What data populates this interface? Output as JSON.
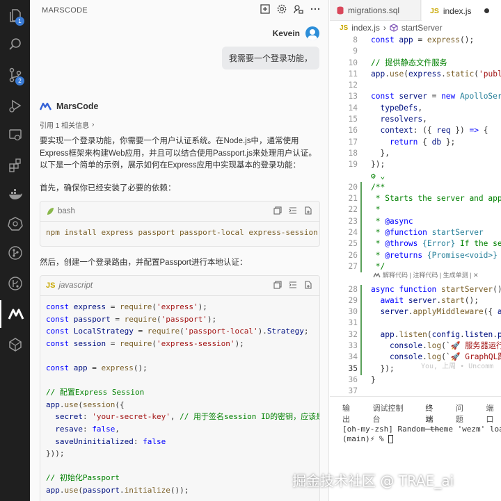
{
  "activity_bar": {
    "explorer_badge": "1",
    "scm_badge": "2"
  },
  "panel": {
    "title": "MARSCODE",
    "user_name": "Kevein",
    "user_message": "我需要一个登录功能，",
    "assistant_name": "MarsCode",
    "reference_info": "引用 1 相关信息",
    "para1": "要实现一个登录功能，你需要一个用户认证系统。在Node.js中，通常使用Express框架来构建Web应用，并且可以结合使用Passport.js来处理用户认证。以下是一个简单的示例，展示如何在Express应用中实现基本的登录功能：",
    "para2": "首先，确保你已经安装了必要的依赖：",
    "bash_lang": "bash",
    "bash_code": "npm install express passport passport-local express-session",
    "para3": "然后，创建一个登录路由，并配置Passport进行本地认证：",
    "js_lang": "javascript",
    "js_lines": [
      [
        [
          "kw",
          "const "
        ],
        [
          "vr",
          "express"
        ],
        [
          "plain",
          " = "
        ],
        [
          "fn",
          "require"
        ],
        [
          "plain",
          "("
        ],
        [
          "str",
          "'express'"
        ],
        [
          "plain",
          ");"
        ]
      ],
      [
        [
          "kw",
          "const "
        ],
        [
          "vr",
          "passport"
        ],
        [
          "plain",
          " = "
        ],
        [
          "fn",
          "require"
        ],
        [
          "plain",
          "("
        ],
        [
          "str",
          "'passport'"
        ],
        [
          "plain",
          ");"
        ]
      ],
      [
        [
          "kw",
          "const "
        ],
        [
          "vr",
          "LocalStrategy"
        ],
        [
          "plain",
          " = "
        ],
        [
          "fn",
          "require"
        ],
        [
          "plain",
          "("
        ],
        [
          "str",
          "'passport-local'"
        ],
        [
          "plain",
          ")."
        ],
        [
          "vr",
          "Strategy"
        ],
        [
          "plain",
          ";"
        ]
      ],
      [
        [
          "kw",
          "const "
        ],
        [
          "vr",
          "session"
        ],
        [
          "plain",
          " = "
        ],
        [
          "fn",
          "require"
        ],
        [
          "plain",
          "("
        ],
        [
          "str",
          "'express-session'"
        ],
        [
          "plain",
          ");"
        ]
      ],
      [],
      [
        [
          "kw",
          "const "
        ],
        [
          "vr",
          "app"
        ],
        [
          "plain",
          " = "
        ],
        [
          "fn",
          "express"
        ],
        [
          "plain",
          "();"
        ]
      ],
      [],
      [
        [
          "cm",
          "// 配置Express Session"
        ]
      ],
      [
        [
          "vr",
          "app"
        ],
        [
          "plain",
          "."
        ],
        [
          "fn",
          "use"
        ],
        [
          "plain",
          "("
        ],
        [
          "fn",
          "session"
        ],
        [
          "plain",
          "({"
        ]
      ],
      [
        [
          "plain",
          "  "
        ],
        [
          "vr",
          "secret"
        ],
        [
          "plain",
          ": "
        ],
        [
          "str",
          "'your-secret-key'"
        ],
        [
          "plain",
          ", "
        ],
        [
          "cm",
          "// 用于签名session ID的密钥，应该是"
        ]
      ],
      [
        [
          "plain",
          "  "
        ],
        [
          "vr",
          "resave"
        ],
        [
          "plain",
          ": "
        ],
        [
          "kv",
          "false"
        ],
        [
          "plain",
          ","
        ]
      ],
      [
        [
          "plain",
          "  "
        ],
        [
          "vr",
          "saveUninitialized"
        ],
        [
          "plain",
          ": "
        ],
        [
          "kv",
          "false"
        ]
      ],
      [
        [
          "plain",
          "}));"
        ]
      ],
      [],
      [
        [
          "cm",
          "// 初始化Passport"
        ]
      ],
      [
        [
          "vr",
          "app"
        ],
        [
          "plain",
          "."
        ],
        [
          "fn",
          "use"
        ],
        [
          "plain",
          "("
        ],
        [
          "vr",
          "passport"
        ],
        [
          "plain",
          "."
        ],
        [
          "fn",
          "initialize"
        ],
        [
          "plain",
          "());"
        ]
      ]
    ]
  },
  "editor": {
    "tabs": [
      {
        "label": "migrations.sql",
        "icon": "database-icon",
        "active": false
      },
      {
        "label": "index.js",
        "icon": "js-icon",
        "active": true
      }
    ],
    "breadcrumb_file": "index.js",
    "breadcrumb_symbol": "startServer",
    "codelens": "解释代码 | 注释代码 | 生成单测 | ✕",
    "ghost_text": "You, 上周 • Uncomm",
    "lines": [
      {
        "n": "8",
        "t": [
          [
            "kw",
            "const "
          ],
          [
            "vr",
            "app"
          ],
          [
            "plain",
            " = "
          ],
          [
            "fn",
            "express"
          ],
          [
            "plain",
            "();"
          ]
        ]
      },
      {
        "n": "9",
        "t": []
      },
      {
        "n": "10",
        "t": [
          [
            "cm",
            "// 提供静态文件服务"
          ]
        ]
      },
      {
        "n": "11",
        "t": [
          [
            "vr",
            "app"
          ],
          [
            "plain",
            "."
          ],
          [
            "fn",
            "use"
          ],
          [
            "plain",
            "("
          ],
          [
            "vr",
            "express"
          ],
          [
            "plain",
            "."
          ],
          [
            "fn",
            "static"
          ],
          [
            "plain",
            "("
          ],
          [
            "str",
            "'publi"
          ]
        ]
      },
      {
        "n": "12",
        "t": []
      },
      {
        "n": "13",
        "t": [
          [
            "kw",
            "const "
          ],
          [
            "vr",
            "server"
          ],
          [
            "plain",
            " = "
          ],
          [
            "kw",
            "new "
          ],
          [
            "cls",
            "ApolloServ"
          ]
        ]
      },
      {
        "n": "14",
        "t": [
          [
            "plain",
            "  "
          ],
          [
            "vr",
            "typeDefs"
          ],
          [
            "plain",
            ","
          ]
        ]
      },
      {
        "n": "15",
        "t": [
          [
            "plain",
            "  "
          ],
          [
            "vr",
            "resolvers"
          ],
          [
            "plain",
            ","
          ]
        ]
      },
      {
        "n": "16",
        "t": [
          [
            "plain",
            "  "
          ],
          [
            "vr",
            "context"
          ],
          [
            "plain",
            ": ({ "
          ],
          [
            "vr",
            "req"
          ],
          [
            "plain",
            " }) "
          ],
          [
            "kw",
            "=>"
          ],
          [
            "plain",
            " {"
          ]
        ]
      },
      {
        "n": "17",
        "t": [
          [
            "plain",
            "    "
          ],
          [
            "kw",
            "return"
          ],
          [
            "plain",
            " { "
          ],
          [
            "vr",
            "db"
          ],
          [
            "plain",
            " };"
          ]
        ]
      },
      {
        "n": "18",
        "t": [
          [
            "plain",
            "  },"
          ]
        ]
      },
      {
        "n": "19",
        "t": [
          [
            "plain",
            "});"
          ]
        ]
      },
      {
        "n": "",
        "t": [
          [
            "cm",
            "⚙ ⌄"
          ]
        ]
      },
      {
        "n": "20",
        "t": [
          [
            "cm",
            "/**"
          ]
        ]
      },
      {
        "n": "21",
        "t": [
          [
            "cm",
            " * Starts the server and appl"
          ]
        ]
      },
      {
        "n": "22",
        "t": [
          [
            "cm",
            " *"
          ]
        ]
      },
      {
        "n": "23",
        "t": [
          [
            "cm",
            " * "
          ],
          [
            "kw",
            "@async"
          ]
        ]
      },
      {
        "n": "24",
        "t": [
          [
            "cm",
            " * "
          ],
          [
            "kw",
            "@function "
          ],
          [
            "ty",
            "startServer"
          ]
        ]
      },
      {
        "n": "25",
        "t": [
          [
            "cm",
            " * "
          ],
          [
            "kw",
            "@throws "
          ],
          [
            "ty",
            "{Error}"
          ],
          [
            "cm",
            " If the ser"
          ]
        ]
      },
      {
        "n": "26",
        "t": [
          [
            "cm",
            " * "
          ],
          [
            "kw",
            "@returns "
          ],
          [
            "ty",
            "{Promise<void>}"
          ],
          [
            "cm",
            " A"
          ]
        ]
      },
      {
        "n": "27",
        "t": [
          [
            "cm",
            " */"
          ]
        ]
      },
      {
        "n": "",
        "t": []
      },
      {
        "n": "28",
        "t": [
          [
            "kw",
            "async function "
          ],
          [
            "fn",
            "startServer"
          ],
          [
            "plain",
            "()"
          ]
        ]
      },
      {
        "n": "29",
        "t": [
          [
            "plain",
            "  "
          ],
          [
            "kw",
            "await "
          ],
          [
            "vr",
            "server"
          ],
          [
            "plain",
            "."
          ],
          [
            "fn",
            "start"
          ],
          [
            "plain",
            "();"
          ]
        ]
      },
      {
        "n": "30",
        "t": [
          [
            "plain",
            "  "
          ],
          [
            "vr",
            "server"
          ],
          [
            "plain",
            "."
          ],
          [
            "fn",
            "applyMiddleware"
          ],
          [
            "plain",
            "({ "
          ],
          [
            "vr",
            "ap"
          ]
        ]
      },
      {
        "n": "31",
        "t": []
      },
      {
        "n": "32",
        "t": [
          [
            "plain",
            "  "
          ],
          [
            "vr",
            "app"
          ],
          [
            "plain",
            "."
          ],
          [
            "fn",
            "listen"
          ],
          [
            "plain",
            "("
          ],
          [
            "vr",
            "config"
          ],
          [
            "plain",
            "."
          ],
          [
            "vr",
            "listen"
          ],
          [
            "plain",
            "."
          ],
          [
            "vr",
            "po"
          ]
        ]
      },
      {
        "n": "33",
        "t": [
          [
            "plain",
            "    "
          ],
          [
            "vr",
            "console"
          ],
          [
            "plain",
            "."
          ],
          [
            "fn",
            "log"
          ],
          [
            "plain",
            "(`"
          ],
          [
            "str",
            "🚀 服务器运行在"
          ]
        ]
      },
      {
        "n": "34",
        "t": [
          [
            "plain",
            "    "
          ],
          [
            "vr",
            "console"
          ],
          [
            "plain",
            "."
          ],
          [
            "fn",
            "log"
          ],
          [
            "plain",
            "(`"
          ],
          [
            "str",
            "🚀 GraphQL路径"
          ]
        ]
      },
      {
        "n": "35",
        "t": [
          [
            "plain",
            "  });"
          ]
        ]
      },
      {
        "n": "36",
        "t": [
          [
            "plain",
            "}"
          ]
        ]
      },
      {
        "n": "37",
        "t": []
      }
    ],
    "terminal_tabs": [
      "输出",
      "调试控制台",
      "终端",
      "问题",
      "端口"
    ],
    "terminal_active": "终端",
    "terminal_line1": "[oh-my-zsh] Random theme 'wezm' load",
    "terminal_prompt": "(main)⚡  %"
  },
  "watermark": "掘金技术社区 @ TRAE_ai"
}
